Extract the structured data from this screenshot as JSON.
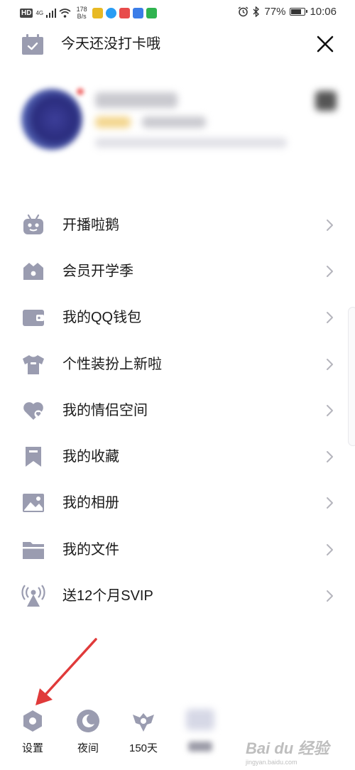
{
  "status_bar": {
    "hd": "HD",
    "network": "4G",
    "speed_value": "178",
    "speed_unit": "B/s",
    "battery_percent": "77%",
    "battery_level": 0.77,
    "time": "10:06",
    "app_icon_colors": [
      "#e8b923",
      "#2a9df4",
      "#e84b4b",
      "#3b7de8",
      "#2fb34f"
    ]
  },
  "header": {
    "checkin_text": "今天还没打卡哦"
  },
  "menu": {
    "items": [
      {
        "label": "开播啦鹅",
        "icon": "robot-icon"
      },
      {
        "label": "会员开学季",
        "icon": "vip-crown-icon"
      },
      {
        "label": "我的QQ钱包",
        "icon": "wallet-icon"
      },
      {
        "label": "个性装扮上新啦",
        "icon": "tshirt-icon"
      },
      {
        "label": "我的情侣空间",
        "icon": "heart-icon"
      },
      {
        "label": "我的收藏",
        "icon": "bookmark-icon"
      },
      {
        "label": "我的相册",
        "icon": "photo-icon"
      },
      {
        "label": "我的文件",
        "icon": "folder-icon"
      },
      {
        "label": "送12个月SVIP",
        "icon": "broadcast-icon"
      }
    ]
  },
  "bottom_bar": {
    "settings_label": "设置",
    "night_label": "夜间",
    "days_label": "150天"
  },
  "colors": {
    "icon_gray": "#9a9cb0",
    "arrow_red": "#e03a3a"
  },
  "watermark": {
    "text": "Bai du 经验",
    "sub": "jingyan.baidu.com"
  }
}
